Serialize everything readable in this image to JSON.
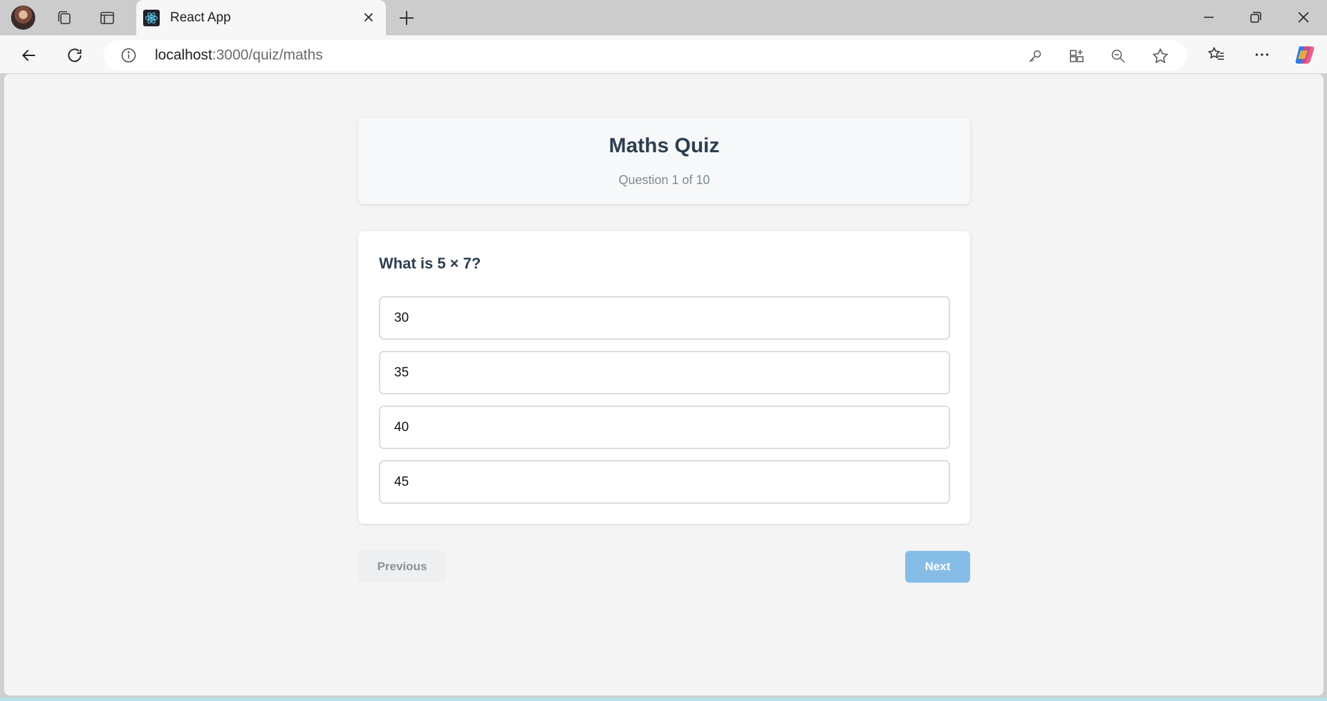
{
  "browser": {
    "tab_title": "React App",
    "url_host": "localhost",
    "url_path": ":3000/quiz/maths",
    "icons": [
      "profile-avatar",
      "workspaces-icon",
      "tab-actions-icon",
      "react-favicon",
      "close-icon",
      "new-tab-icon",
      "minimize-icon",
      "restore-icon",
      "close-window-icon",
      "back-icon",
      "refresh-icon",
      "site-info-icon",
      "password-key-icon",
      "app-available-icon",
      "zoom-out-icon",
      "favorite-star-icon",
      "favorites-icon",
      "more-icon",
      "copilot-icon"
    ]
  },
  "quiz": {
    "title": "Maths Quiz",
    "progress": "Question 1 of 10",
    "question": "What is 5 × 7?",
    "options": [
      "30",
      "35",
      "40",
      "45"
    ],
    "previous_label": "Previous",
    "next_label": "Next"
  },
  "colors": {
    "title": "#2c3e50",
    "next_button": "#86bde6",
    "page_bg": "#f4f4f4"
  }
}
